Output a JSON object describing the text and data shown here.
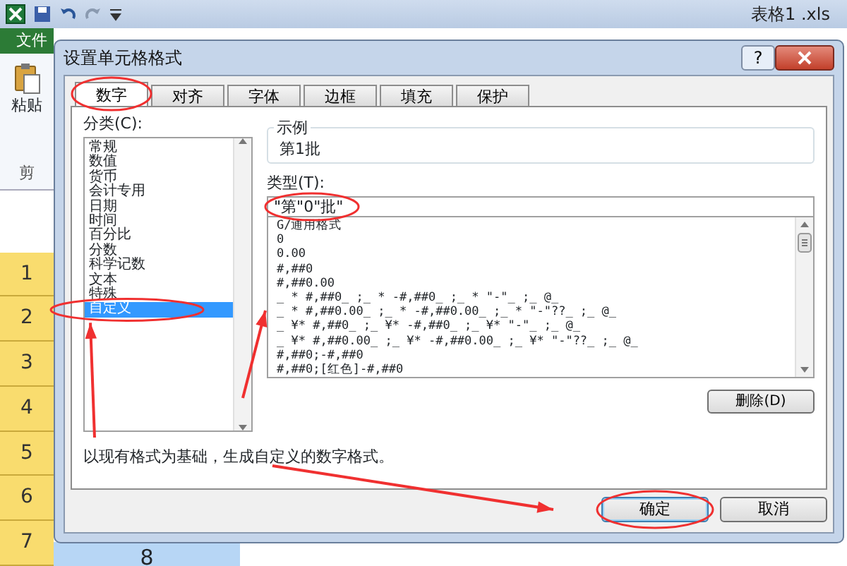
{
  "app": {
    "title": "表格1 .xls",
    "file_tab": "文件",
    "paste_label": "粘贴",
    "clipboard_group": "剪",
    "row_headers": [
      "1",
      "2",
      "3",
      "4",
      "5",
      "6",
      "7"
    ],
    "cell": "8"
  },
  "dialog": {
    "title": "设置单元格格式",
    "help": "?",
    "tabs": [
      {
        "label": "数字",
        "selected": true
      },
      {
        "label": "对齐",
        "selected": false
      },
      {
        "label": "字体",
        "selected": false
      },
      {
        "label": "边框",
        "selected": false
      },
      {
        "label": "填充",
        "selected": false
      },
      {
        "label": "保护",
        "selected": false
      }
    ],
    "category": {
      "label": "分类(C):",
      "items": [
        {
          "label": "常规",
          "selected": false
        },
        {
          "label": "数值",
          "selected": false
        },
        {
          "label": "货币",
          "selected": false
        },
        {
          "label": "会计专用",
          "selected": false
        },
        {
          "label": "日期",
          "selected": false
        },
        {
          "label": "时间",
          "selected": false
        },
        {
          "label": "百分比",
          "selected": false
        },
        {
          "label": "分数",
          "selected": false
        },
        {
          "label": "科学记数",
          "selected": false
        },
        {
          "label": "文本",
          "selected": false
        },
        {
          "label": "特殊",
          "selected": false
        },
        {
          "label": "自定义",
          "selected": true
        }
      ]
    },
    "sample": {
      "legend": "示例",
      "value": "第1批"
    },
    "type": {
      "label": "类型(T):",
      "value": "\"第\"0\"批\"",
      "formats": [
        "G/通用格式",
        "0",
        "0.00",
        "#,##0",
        "#,##0.00",
        "_ * #,##0_ ;_ * -#,##0_ ;_ * \"-\"_ ;_ @_",
        "_ * #,##0.00_ ;_ * -#,##0.00_ ;_ * \"-\"??_ ;_ @_",
        "_ ¥* #,##0_ ;_ ¥* -#,##0_ ;_ ¥* \"-\"_ ;_ @_",
        "_ ¥* #,##0.00_ ;_ ¥* -#,##0.00_ ;_ ¥* \"-\"??_ ;_ @_",
        "#,##0;-#,##0",
        "#,##0;[红色]-#,##0"
      ]
    },
    "delete_button": "删除(D)",
    "description": "以现有格式为基础，生成自定义的数字格式。",
    "buttons": [
      {
        "label": "确定",
        "default": true
      },
      {
        "label": "取消",
        "default": false
      }
    ]
  }
}
